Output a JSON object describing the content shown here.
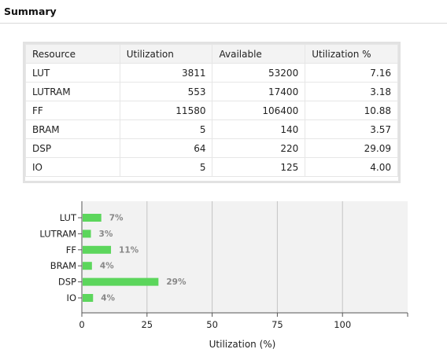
{
  "header": {
    "title": "Summary"
  },
  "table": {
    "columns": [
      "Resource",
      "Utilization",
      "Available",
      "Utilization %"
    ],
    "rows": [
      [
        "LUT",
        "3811",
        "53200",
        "7.16"
      ],
      [
        "LUTRAM",
        "553",
        "17400",
        "3.18"
      ],
      [
        "FF",
        "11580",
        "106400",
        "10.88"
      ],
      [
        "BRAM",
        "5",
        "140",
        "3.57"
      ],
      [
        "DSP",
        "64",
        "220",
        "29.09"
      ],
      [
        "IO",
        "5",
        "125",
        "4.00"
      ]
    ]
  },
  "chart_data": {
    "type": "bar",
    "orientation": "horizontal",
    "categories": [
      "LUT",
      "LUTRAM",
      "FF",
      "BRAM",
      "DSP",
      "IO"
    ],
    "values": [
      7.16,
      3.18,
      10.88,
      3.57,
      29.09,
      4.0
    ],
    "data_labels": [
      "7%",
      "3%",
      "11%",
      "4%",
      "29%",
      "4%"
    ],
    "xticks": [
      "0",
      "25",
      "50",
      "75",
      "100"
    ],
    "xlim": [
      0,
      125
    ],
    "xlabel": "Utilization (%)",
    "grid": true,
    "bar_color": "#5cd65c",
    "plot_background": "#f2f2f2"
  }
}
